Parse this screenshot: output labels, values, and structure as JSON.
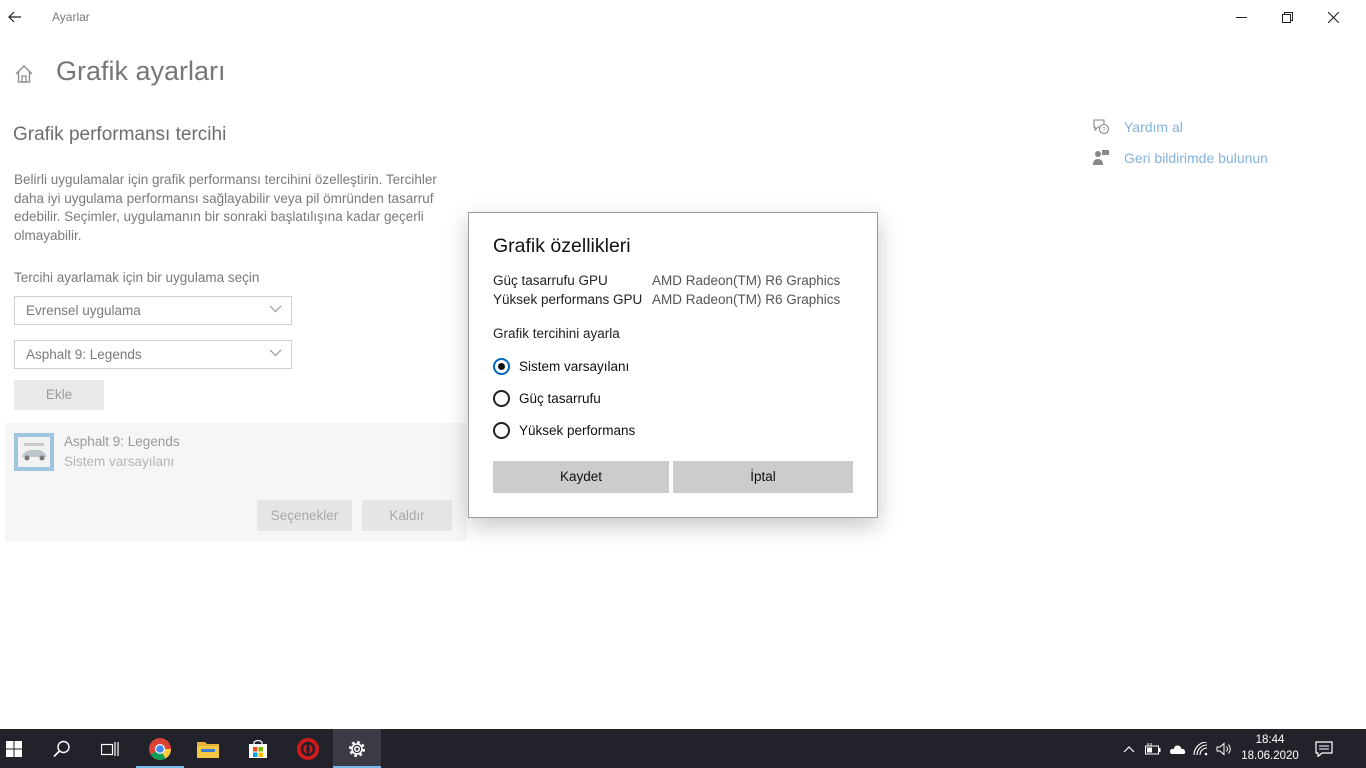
{
  "window": {
    "app_title": "Ayarlar"
  },
  "page": {
    "title": "Grafik ayarları",
    "section_title": "Grafik performansı tercihi",
    "description": "Belirli uygulamalar için grafik performansı tercihini özelleştirin. Tercihler daha iyi uygulama performansı sağlayabilir veya pil ömründen tasarruf edebilir. Seçimler, uygulamanın bir sonraki başlatılışına kadar geçerli olmayabilir.",
    "choose_label": "Tercihi ayarlamak için bir uygulama seçin",
    "app_type_select": "Evrensel uygulama",
    "app_select": "Asphalt 9: Legends",
    "add_button": "Ekle"
  },
  "app_card": {
    "name": "Asphalt 9: Legends",
    "preference": "Sistem varsayılanı",
    "options_button": "Seçenekler",
    "remove_button": "Kaldır"
  },
  "help": {
    "get_help": "Yardım al",
    "feedback": "Geri bildirimde bulunun"
  },
  "dialog": {
    "title": "Grafik özellikleri",
    "power_saving_gpu_label": "Güç tasarrufu GPU",
    "power_saving_gpu_value": "AMD Radeon(TM) R6 Graphics",
    "high_perf_gpu_label": "Yüksek performans GPU",
    "high_perf_gpu_value": "AMD Radeon(TM) R6 Graphics",
    "pref_label": "Grafik tercihini ayarla",
    "options": [
      "Sistem varsayılanı",
      "Güç tasarrufu",
      "Yüksek performans"
    ],
    "selected_option": "Sistem varsayılanı",
    "save_button": "Kaydet",
    "cancel_button": "İptal"
  },
  "taskbar": {
    "time": "18:44",
    "date": "18.06.2020",
    "apps": [
      "start-icon",
      "search-icon",
      "task-view-icon",
      "chrome-icon",
      "file-explorer-icon",
      "store-icon",
      "amd-radeon-icon",
      "settings-icon"
    ],
    "active_app": "settings-icon"
  },
  "colors": {
    "accent": "#0067c0",
    "link": "#82b3dc",
    "taskbar": "#22232a",
    "dialog_button": "#cccccc"
  }
}
